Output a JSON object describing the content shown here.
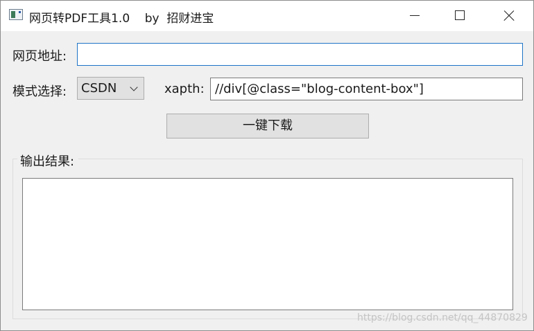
{
  "window": {
    "title": "网页转PDF工具1.0    by  招财进宝"
  },
  "form": {
    "url_label": "网页地址:",
    "url_value": "",
    "mode_label": "模式选择:",
    "mode_selected": "CSDN",
    "xpath_label": "xapth:",
    "xpath_value": "//div[@class=\"blog-content-box\"]",
    "download_label": "一键下载"
  },
  "output": {
    "group_title": "输出结果:",
    "content": ""
  },
  "watermark": "https://blog.csdn.net/qq_44870829",
  "icons": {
    "app": "app-window-icon",
    "minimize": "minimize-icon",
    "maximize": "maximize-icon",
    "close": "close-icon",
    "dropdown": "chevron-down-icon"
  },
  "colors": {
    "window_bg": "#f0f0f0",
    "titlebar_bg": "#ffffff",
    "focus_border": "#1e73c7",
    "button_bg": "#e1e1e1"
  }
}
